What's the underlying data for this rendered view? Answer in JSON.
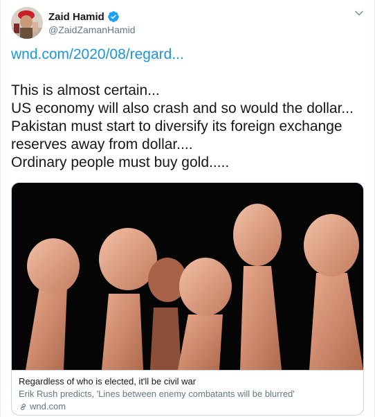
{
  "author": {
    "name": "Zaid Hamid",
    "handle": "@ZaidZamanHamid",
    "verified": true,
    "avatar_icon": "avatar-photo-icon"
  },
  "tweet": {
    "link_text": "wnd.com/2020/08/regard...",
    "lines": [
      "This is almost certain...",
      "US economy will also crash and so would the dollar...",
      "Pakistan must start to diversify its foreign exchange",
      "reserves away from dollar....",
      "Ordinary people must buy gold....."
    ]
  },
  "card": {
    "image_icon": "raised-fists-photo",
    "title": "Regardless of who is elected, it'll be civil war",
    "description": "Erik Rush predicts, 'Lines between enemy combatants will be blurred'",
    "domain": "wnd.com",
    "domain_icon": "link-icon"
  },
  "colors": {
    "link": "#1b95e0",
    "secondary_text": "#657786",
    "verified_badge": "#1da1f2",
    "border": "#ccd6dd"
  }
}
